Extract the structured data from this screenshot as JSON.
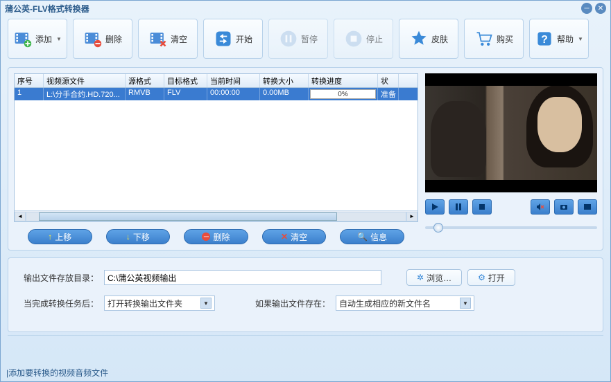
{
  "window": {
    "title": "蒲公英-FLV格式转换器"
  },
  "toolbar": {
    "add": "添加",
    "remove": "删除",
    "clear": "清空",
    "start": "开始",
    "pause": "暂停",
    "stop": "停止",
    "skin": "皮肤",
    "buy": "购买",
    "help": "帮助"
  },
  "table": {
    "headers": [
      "序号",
      "视频源文件",
      "源格式",
      "目标格式",
      "当前时间",
      "转换大小",
      "转换进度",
      "状"
    ],
    "rows": [
      {
        "index": "1",
        "source": "L:\\分手合约.HD.720...",
        "src_fmt": "RMVB",
        "tgt_fmt": "FLV",
        "time": "00:00:00",
        "size": "0.00MB",
        "progress": "0%",
        "status": "准备"
      }
    ]
  },
  "list_buttons": {
    "up": "上移",
    "down": "下移",
    "delete": "删除",
    "clear": "清空",
    "info": "信息"
  },
  "output": {
    "dir_label": "输出文件存放目录：",
    "dir_value": "C:\\蒲公英视频输出",
    "browse": "浏览…",
    "open": "打开",
    "after_label": "当完成转换任务后：",
    "after_value": "打开转换输出文件夹",
    "exists_label": "如果输出文件存在：",
    "exists_value": "自动生成相应的新文件名"
  },
  "status": "添加要转换的视频音频文件"
}
